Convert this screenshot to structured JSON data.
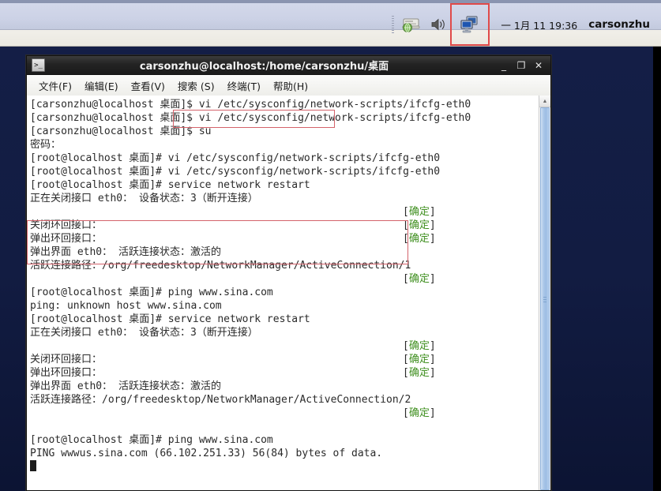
{
  "panel": {
    "tray_icons": [
      {
        "name": "updates-icon",
        "label": "updates"
      },
      {
        "name": "volume-icon",
        "label": "volume"
      },
      {
        "name": "network-monitor-icon",
        "label": "network"
      }
    ],
    "clock": "一 1月 11 19:36",
    "username": "carsonzhu"
  },
  "window": {
    "title": "carsonzhu@localhost:/home/carsonzhu/桌面",
    "icon": ">_",
    "buttons": {
      "minimize": "_",
      "maximize": "❐",
      "close": "✕"
    },
    "menu": [
      {
        "label": "文件(F)"
      },
      {
        "label": "编辑(E)"
      },
      {
        "label": "查看(V)"
      },
      {
        "label": "搜索 (S)"
      },
      {
        "label": "终端(T)"
      },
      {
        "label": "帮助(H)"
      }
    ]
  },
  "terminal": {
    "ok_label": "[确定]",
    "lines": [
      {
        "text": "[carsonzhu@localhost 桌面]$ vi /etc/sysconfig/network-scripts/ifcfg-eth0"
      },
      {
        "text": "[carsonzhu@localhost 桌面]$ vi /etc/sysconfig/network-scripts/ifcfg-eth0"
      },
      {
        "text": "[carsonzhu@localhost 桌面]$ su"
      },
      {
        "text": "密码："
      },
      {
        "text": "[root@localhost 桌面]# vi /etc/sysconfig/network-scripts/ifcfg-eth0"
      },
      {
        "text": "[root@localhost 桌面]# vi /etc/sysconfig/network-scripts/ifcfg-eth0"
      },
      {
        "text": "[root@localhost 桌面]# service network restart"
      },
      {
        "text": "正在关闭接口 eth0： 设备状态：3（断开连接）"
      },
      {
        "text": "",
        "ok": true
      },
      {
        "text": "关闭环回接口：",
        "ok": true
      },
      {
        "text": "弹出环回接口：",
        "ok": true
      },
      {
        "text": "弹出界面 eth0： 活跃连接状态：激活的"
      },
      {
        "text": "活跃连接路径：/org/freedesktop/NetworkManager/ActiveConnection/1"
      },
      {
        "text": "",
        "ok": true
      },
      {
        "text": "[root@localhost 桌面]# ping www.sina.com"
      },
      {
        "text": "ping: unknown host www.sina.com"
      },
      {
        "text": "[root@localhost 桌面]# service network restart"
      },
      {
        "text": "正在关闭接口 eth0： 设备状态：3（断开连接）"
      },
      {
        "text": "",
        "ok": true
      },
      {
        "text": "关闭环回接口：",
        "ok": true
      },
      {
        "text": "弹出环回接口：",
        "ok": true
      },
      {
        "text": "弹出界面 eth0： 活跃连接状态：激活的"
      },
      {
        "text": "活跃连接路径：/org/freedesktop/NetworkManager/ActiveConnection/2"
      },
      {
        "text": "",
        "ok": true
      },
      {
        "text": ""
      },
      {
        "text": "[root@localhost 桌面]# ping www.sina.com"
      },
      {
        "text": "PING wwwus.sina.com (66.102.251.33) 56(84) bytes of data."
      },
      {
        "text": "",
        "cursor": true
      }
    ],
    "annotations": [
      {
        "name": "annotation-box-command",
        "target": "service network restart"
      },
      {
        "name": "annotation-box-ping-result",
        "target": "ping www.sina.com result"
      }
    ]
  },
  "scrollbar": {
    "up_arrow": "▲"
  },
  "colors": {
    "annotation": "#d4636b",
    "ok_green": "#3f8f1f",
    "desktop": "#141f47",
    "panel": "#d3d8ea"
  }
}
